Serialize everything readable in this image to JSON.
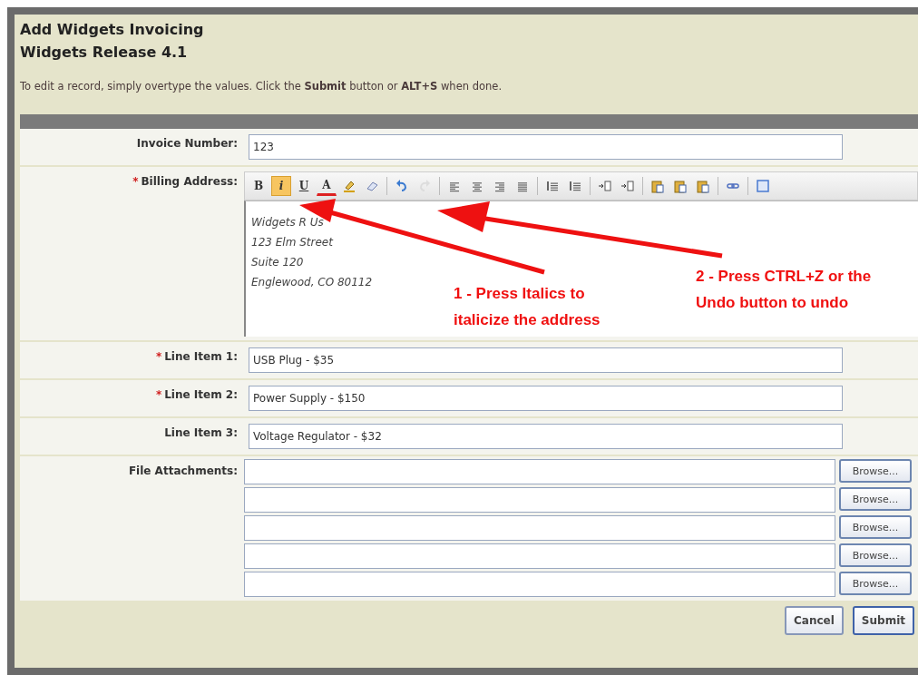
{
  "required_mark": "*",
  "header": {
    "title": "Add Widgets Invoicing",
    "subtitle": "Widgets Release 4.1",
    "instructions": "To edit a record, simply overtype the values. Click the **Submit** button or **ALT+S** when done."
  },
  "invoice": {
    "label": "Invoice Number:",
    "required": false,
    "value": "123"
  },
  "billing": {
    "label": "Billing Address:",
    "required": true,
    "toolbar": [
      {
        "kind": "bold",
        "label": "B",
        "selected": false,
        "disabled": false
      },
      {
        "kind": "italic",
        "label": "i",
        "selected": true,
        "disabled": false
      },
      {
        "kind": "underline",
        "label": "U",
        "selected": false,
        "disabled": false
      },
      {
        "kind": "fontcolor",
        "label": "A",
        "selected": false,
        "disabled": false
      },
      {
        "kind": "highlight",
        "selected": false,
        "disabled": false
      },
      {
        "kind": "eraser",
        "selected": false,
        "disabled": false
      },
      {
        "kind": "sep"
      },
      {
        "kind": "undo",
        "selected": false,
        "disabled": false
      },
      {
        "kind": "redo",
        "selected": false,
        "disabled": true
      },
      {
        "kind": "sep"
      },
      {
        "kind": "alignleft",
        "selected": false,
        "disabled": false
      },
      {
        "kind": "aligncenter",
        "selected": false,
        "disabled": false
      },
      {
        "kind": "alignright",
        "selected": false,
        "disabled": false
      },
      {
        "kind": "justify",
        "selected": false,
        "disabled": false
      },
      {
        "kind": "sep"
      },
      {
        "kind": "orderedlist",
        "selected": false,
        "disabled": false
      },
      {
        "kind": "bulletlist",
        "selected": false,
        "disabled": false
      },
      {
        "kind": "sep"
      },
      {
        "kind": "indent",
        "selected": false,
        "disabled": false
      },
      {
        "kind": "outdent",
        "selected": false,
        "disabled": false
      },
      {
        "kind": "sep"
      },
      {
        "kind": "paste",
        "selected": false,
        "disabled": false
      },
      {
        "kind": "pastetext",
        "selected": false,
        "disabled": false
      },
      {
        "kind": "pasteword",
        "selected": false,
        "disabled": false
      },
      {
        "kind": "sep"
      },
      {
        "kind": "link",
        "selected": false,
        "disabled": false
      },
      {
        "kind": "sep"
      },
      {
        "kind": "fullscreen",
        "selected": false,
        "disabled": false
      }
    ],
    "address_lines": [
      "Widgets R Us",
      "123 Elm Street",
      "Suite 120",
      "Englewood, CO 80112"
    ]
  },
  "line_items": [
    {
      "label": "Line Item 1:",
      "required": true,
      "value": "USB Plug - $35"
    },
    {
      "label": "Line Item 2:",
      "required": true,
      "value": "Power Supply - $150"
    },
    {
      "label": "Line Item 3:",
      "required": false,
      "value": "Voltage Regulator - $32"
    }
  ],
  "attachments": {
    "label": "File Attachments:",
    "rows": [
      {
        "button": "Browse..."
      },
      {
        "button": "Browse..."
      },
      {
        "button": "Browse..."
      },
      {
        "button": "Browse..."
      },
      {
        "button": "Browse..."
      }
    ]
  },
  "buttons": [
    {
      "label": "Cancel",
      "kind": "cancel"
    },
    {
      "label": "Submit",
      "kind": "submit"
    }
  ],
  "annotations": [
    {
      "lines": [
        "1 - Press Italics to",
        "italicize the address"
      ]
    },
    {
      "lines": [
        "2 - Press CTRL+Z or the",
        "Undo button to undo"
      ]
    }
  ]
}
